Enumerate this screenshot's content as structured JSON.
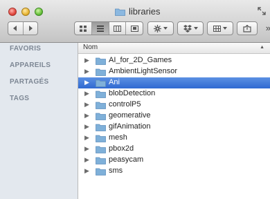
{
  "window": {
    "title": "libraries"
  },
  "toolbar": {
    "back_icon": "back-arrow-icon",
    "forward_icon": "forward-arrow-icon",
    "view_icons": [
      "icon-view-icon",
      "list-view-icon",
      "column-view-icon",
      "cover-flow-icon"
    ],
    "action_icon": "gear-icon",
    "dropbox_icon": "dropbox-icon",
    "arrange_icon": "arrange-grid-icon",
    "share_icon": "share-icon",
    "overflow_label": "»"
  },
  "sidebar": {
    "sections": [
      "FAVORIS",
      "APPAREILS",
      "PARTAGÉS",
      "TAGS"
    ]
  },
  "list": {
    "column_header": "Nom",
    "selected_index": 2,
    "items": [
      "AI_for_2D_Games",
      "AmbientLightSensor",
      "Ani",
      "blobDetection",
      "controlP5",
      "geomerative",
      "gifAnimation",
      "mesh",
      "pbox2d",
      "peasycam",
      "sms"
    ]
  },
  "colors": {
    "selection": "#3d77da",
    "folder": "#7fb0d9",
    "sidebar_bg": "#e3e8ee"
  }
}
